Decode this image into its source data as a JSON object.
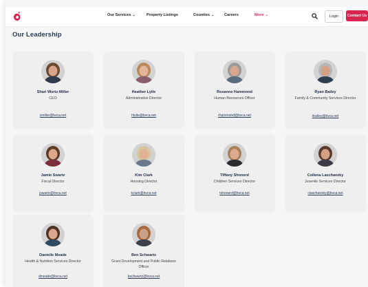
{
  "nav": {
    "items": [
      {
        "label": "Our Services",
        "chevron": true
      },
      {
        "label": "Property Listings",
        "chevron": false
      },
      {
        "label": "Counties",
        "chevron": true
      },
      {
        "label": "Careers",
        "chevron": false
      },
      {
        "label": "More",
        "chevron": true
      }
    ],
    "login": "Login",
    "contact": "Contact Us"
  },
  "colors": {
    "accent": "#d8254f",
    "heading": "#2a3b57",
    "card_bg": "#efefef"
  },
  "page": {
    "title": "Our Leadership"
  },
  "leaders": [
    {
      "name": "Shari Wurtz-Miller",
      "role": "CEO",
      "email": "smiller@bvca.net"
    },
    {
      "name": "Heather Lytle",
      "role": "Administrative Director",
      "email": "hlytle@bvca.net"
    },
    {
      "name": "Roxanne Hammond",
      "role": "Human Resources Officer",
      "email": "rhammond@bvca.net"
    },
    {
      "name": "Ryan Bailey",
      "role": "Family & Community Services Director",
      "email": "rbailey@bvca.net"
    },
    {
      "name": "Jamie Swartz",
      "role": "Fiscal Director",
      "email": "jswartz@bvca.net"
    },
    {
      "name": "Kim Clark",
      "role": "Housing Director",
      "email": "kclark@bvca.net"
    },
    {
      "name": "Tiffany Shonerd",
      "role": "Children Services Director",
      "email": "tshonerd@bvca.net"
    },
    {
      "name": "Collena Laschanzky",
      "role": "Juvenile Services Director",
      "email": "claschanzky@bvca.net"
    },
    {
      "name": "Danielle Meade",
      "role": "Health & Nutrition Services Director",
      "email": "dmeade@bvca.net"
    },
    {
      "name": "Ben Schwartz",
      "role": "Grant Development and Public Relations Officer",
      "email": "bschwartz@bvca.net"
    }
  ]
}
